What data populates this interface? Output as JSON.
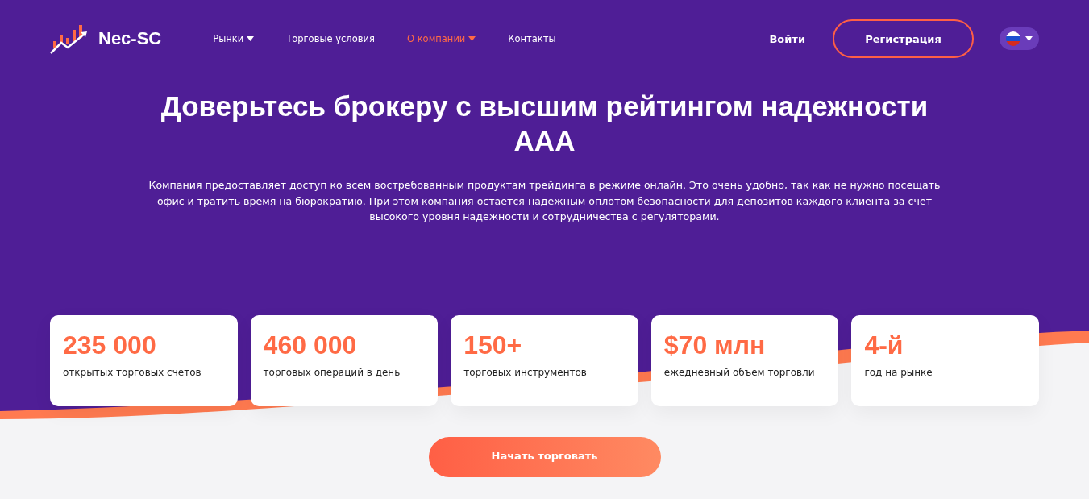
{
  "logo": {
    "text": "Nec-SC"
  },
  "nav": [
    {
      "label": "Рынки",
      "dropdown": true,
      "selected": false
    },
    {
      "label": "Торговые условия",
      "dropdown": false,
      "selected": false
    },
    {
      "label": "О компании",
      "dropdown": true,
      "selected": true
    },
    {
      "label": "Контакты",
      "dropdown": false,
      "selected": false
    }
  ],
  "login": "Войти",
  "register": "Регистрация",
  "language": {
    "expanded": false
  },
  "hero": {
    "title": "Доверьтесь брокеру с высшим рейтингом надежности ААА",
    "text": "Компания предоставляет доступ ко всем востребованным продуктам трейдинга в режиме онлайн. Это очень удобно, так как не нужно посещать офис и тратить время на бюрократию. При этом компания остается надежным оплотом безопасности для депозитов каждого клиента за счет высокого уровня надежности и сотрудничества с регуляторами."
  },
  "stats": [
    {
      "value": "235 000",
      "label": "открытых торговых счетов"
    },
    {
      "value": "460 000",
      "label": "торговых операций в день"
    },
    {
      "value": "150+",
      "label": "торговых инструментов"
    },
    {
      "value": "$70 млн",
      "label": "ежедневный объем торговли"
    },
    {
      "value": "4-й",
      "label": "год на рынке"
    }
  ],
  "cta": "Начать торговать"
}
